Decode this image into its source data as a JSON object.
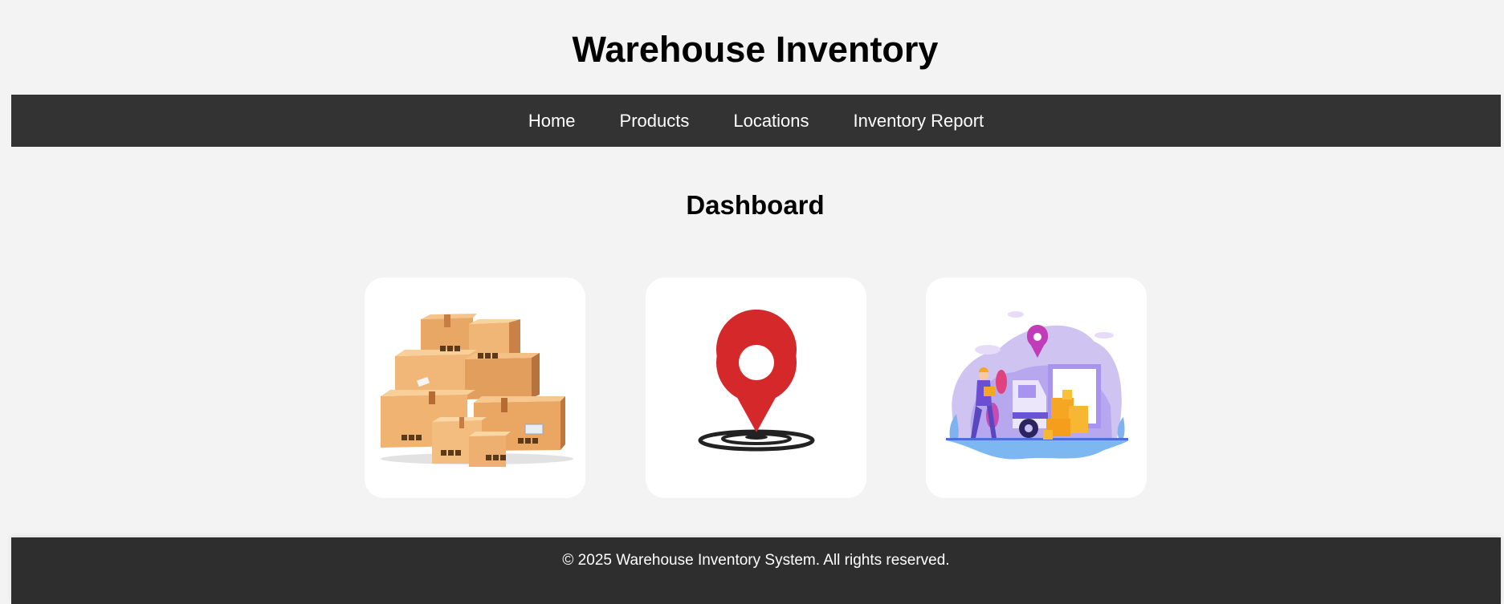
{
  "header": {
    "title": "Warehouse Inventory"
  },
  "nav": {
    "items": [
      {
        "label": "Home"
      },
      {
        "label": "Products"
      },
      {
        "label": "Locations"
      },
      {
        "label": "Inventory Report"
      }
    ]
  },
  "main": {
    "section_title": "Dashboard",
    "cards": [
      {
        "icon": "cardboard-boxes-icon"
      },
      {
        "icon": "location-pin-icon"
      },
      {
        "icon": "delivery-truck-illustration-icon"
      }
    ]
  },
  "footer": {
    "copyright": "© 2025 Warehouse Inventory System. All rights reserved."
  },
  "colors": {
    "background": "#f3f3f3",
    "nav_background": "#333333",
    "footer_background": "#2e2e2e",
    "card_background": "#ffffff",
    "pin_red": "#d4282b"
  }
}
